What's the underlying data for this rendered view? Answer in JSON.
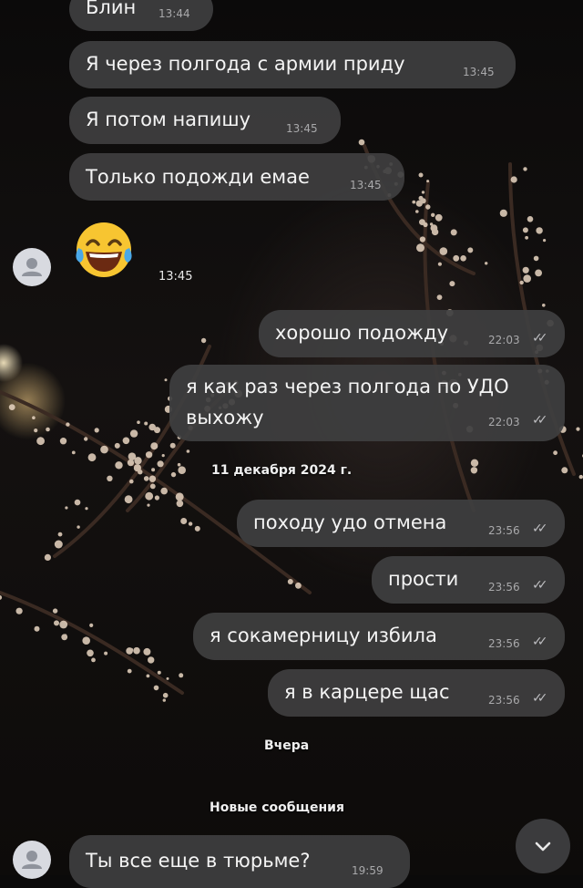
{
  "messages_in_top": [
    {
      "text": "Блин",
      "time": "13:44"
    },
    {
      "text": "Я через полгода с армии приду",
      "time": "13:45"
    },
    {
      "text": "Я потом напишу",
      "time": "13:45"
    },
    {
      "text": "Только подожди емае",
      "time": "13:45"
    }
  ],
  "emoji_message": {
    "emoji": "laughing-tears-emoji",
    "time": "13:45"
  },
  "messages_out_1": [
    {
      "text": "хорошо подожду",
      "time": "22:03"
    },
    {
      "line1": "я как раз через полгода по УДО",
      "line2": "выхожу",
      "time": "22:03"
    }
  ],
  "date_separator": "11 декабря 2024 г.",
  "messages_out_2": [
    {
      "text": "походу удо отмена",
      "time": "23:56"
    },
    {
      "text": "прости",
      "time": "23:56"
    },
    {
      "text": "я сокамерницу избила",
      "time": "23:56"
    },
    {
      "text": "я в карцере щас",
      "time": "23:56"
    }
  ],
  "yesterday_separator": "Вчера",
  "new_messages_label": "Новые сообщения",
  "last_incoming": {
    "text": "Ты все еще в тюрьме?",
    "time": "19:59"
  },
  "read_receipt_icon": "double-check-icon",
  "scroll_button_icon": "chevron-down-icon",
  "colors": {
    "bubble": "#3e3e40",
    "time": "#a9a9ab",
    "avatar": "#d8dae0"
  }
}
